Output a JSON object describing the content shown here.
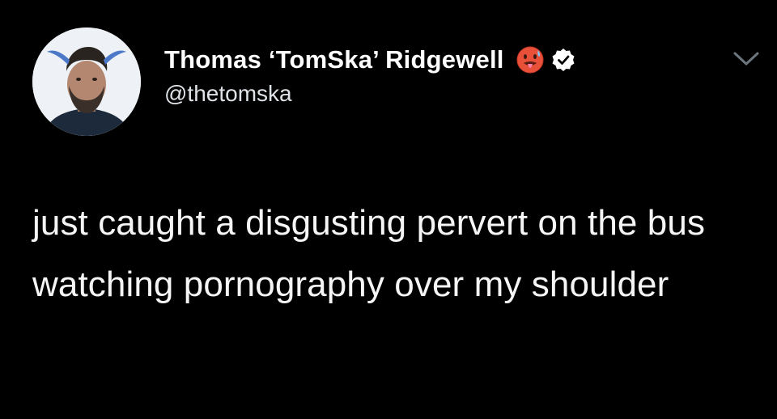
{
  "tweet": {
    "author": {
      "display_name": "Thomas ‘TomSka’ Ridgewell",
      "handle": "@thetomska",
      "avatar": "avatar-photo",
      "name_emoji": "hot-face-emoji",
      "verified_badge": "verified-badge-icon"
    },
    "menu_icon": "chevron-down-icon",
    "text": "just caught a disgusting pervert on the bus watching pornography over my shoulder"
  },
  "colors": {
    "background": "#000000",
    "text": "#ffffff",
    "handle": "#dfe3e8",
    "chevron": "#6e767d"
  }
}
